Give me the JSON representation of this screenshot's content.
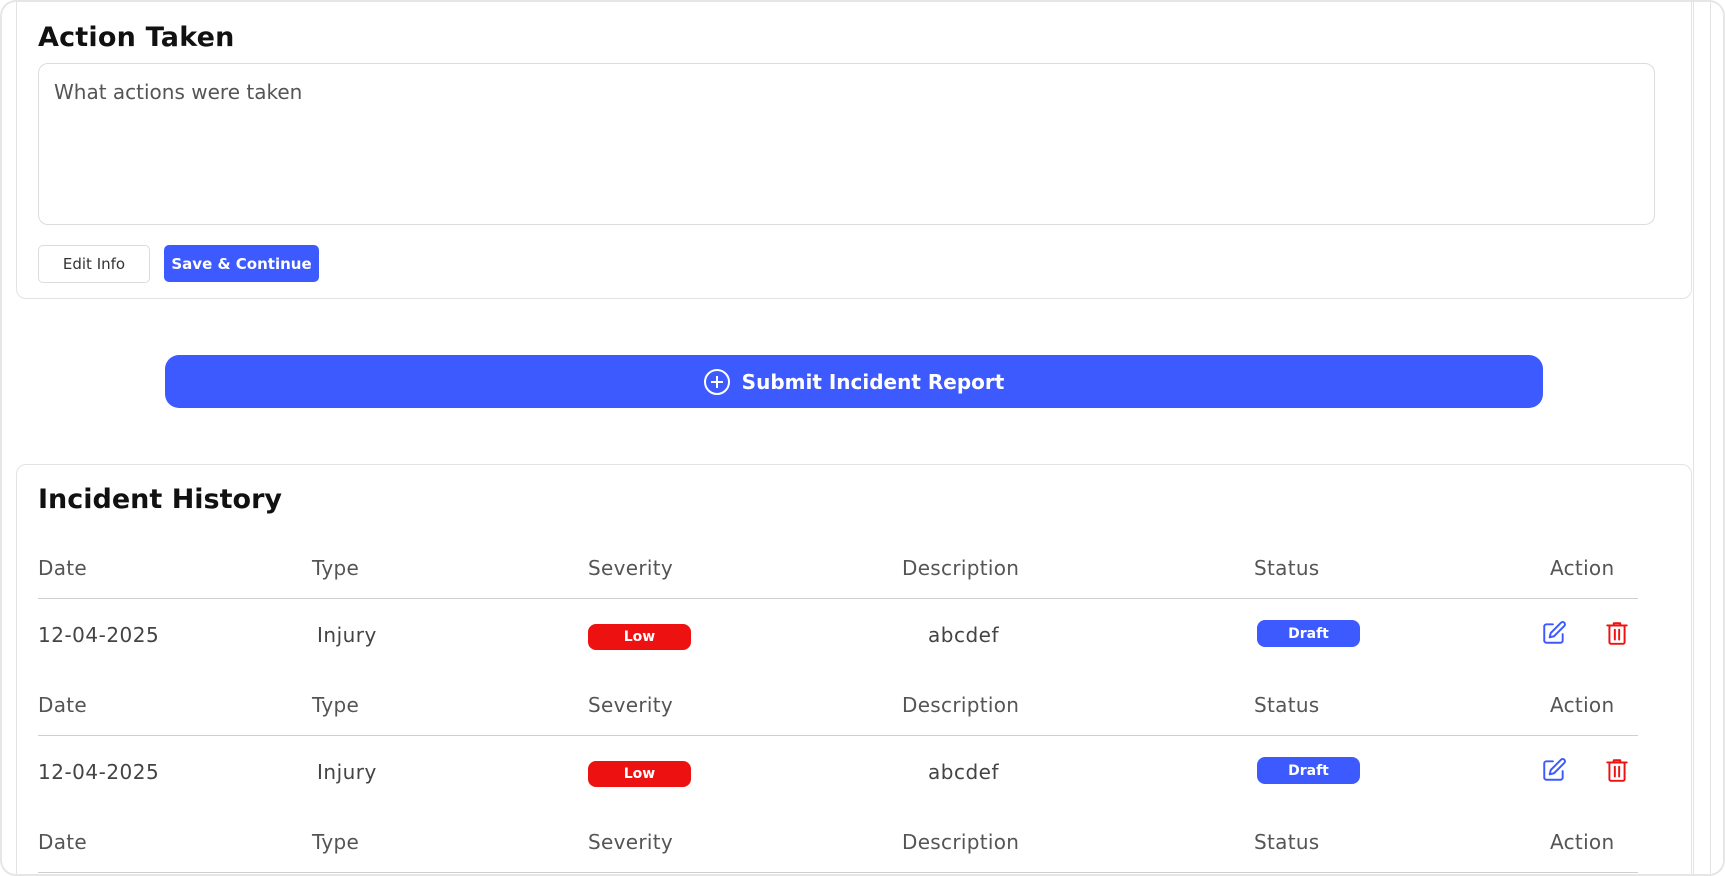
{
  "action_taken": {
    "title": "Action Taken",
    "placeholder": "What actions were taken",
    "value": "",
    "edit_label": "Edit Info",
    "save_label": "Save & Continue"
  },
  "submit": {
    "label": "Submit Incident Report",
    "icon": "plus-circle-icon"
  },
  "history": {
    "title": "Incident History",
    "columns": [
      "Date",
      "Type",
      "Severity",
      "Description",
      "Status",
      "Action"
    ],
    "rows": [
      {
        "date": "12-04-2025",
        "type": "Injury",
        "severity": "Low",
        "description": "abcdef",
        "status": "Draft",
        "actions": [
          "edit-icon",
          "trash-icon"
        ]
      },
      {
        "date": "12-04-2025",
        "type": "Injury",
        "severity": "Low",
        "description": "abcdef",
        "status": "Draft",
        "actions": [
          "edit-icon",
          "trash-icon"
        ]
      }
    ]
  },
  "colors": {
    "primary": "#3d5afe",
    "danger": "#ee1111",
    "border": "#e3e3e3"
  }
}
